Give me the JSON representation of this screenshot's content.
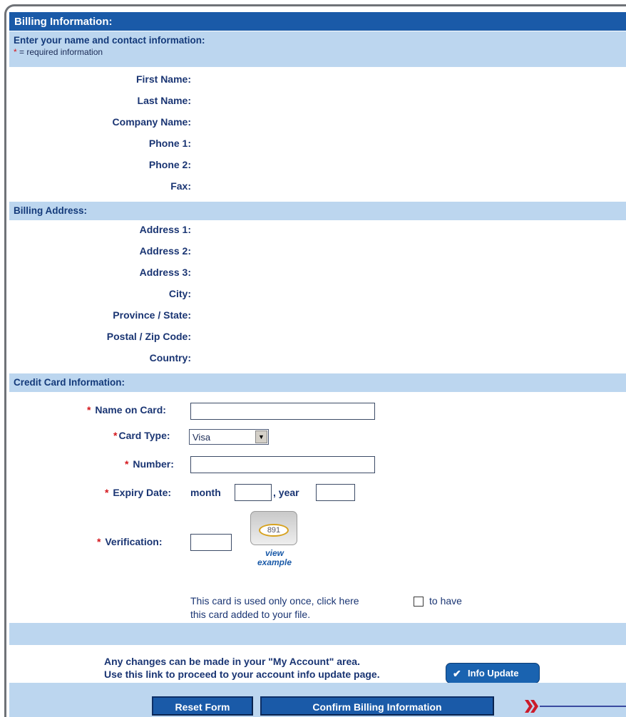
{
  "title": "Billing Information:",
  "contact_section": {
    "heading": "Enter your name and contact information:",
    "required_marker": "*",
    "required_note": " = required information",
    "labels": [
      "First Name:",
      "Last Name:",
      "Company Name:",
      "Phone 1:",
      "Phone 2:",
      "Fax:"
    ]
  },
  "address_section": {
    "heading": "Billing Address:",
    "labels": [
      "Address 1:",
      "Address 2:",
      "Address 3:",
      "City:",
      "Province / State:",
      "Postal / Zip Code:",
      "Country:"
    ]
  },
  "card_section": {
    "heading": "Credit Card Information:",
    "required_marker": "*",
    "name_on_card_label": "Name on Card:",
    "name_on_card_value": "",
    "card_type_label": "Card Type:",
    "card_type_value": "Visa",
    "number_label": "Number:",
    "number_value": "",
    "expiry_label": "Expiry Date:",
    "month_label": "month",
    "month_value": "",
    "year_label": ", year",
    "year_value": "",
    "verification_label": "Verification:",
    "verification_value": "",
    "cvv_sample": "891",
    "view_example_line1": "view",
    "view_example_line2": "example",
    "once_text_1": "This card is used only once, click here",
    "once_text_2": "to have",
    "once_text_3": "this card added to your file.",
    "add_to_file_checked": false
  },
  "account_note": {
    "line1": "Any changes can be made in your \"My Account\" area.",
    "line2": "Use this link to proceed to your account info update page.",
    "info_update_label": "Info Update"
  },
  "buttons": {
    "reset_label": "Reset Form",
    "confirm_label": "Confirm Billing Information"
  },
  "colors": {
    "title_bar": "#1a5aa8",
    "section_band": "#bcd6ef",
    "required_star": "#d4161c",
    "pointer_arrow": "#cc1b2a",
    "pointer_line": "#3a4aa0"
  }
}
